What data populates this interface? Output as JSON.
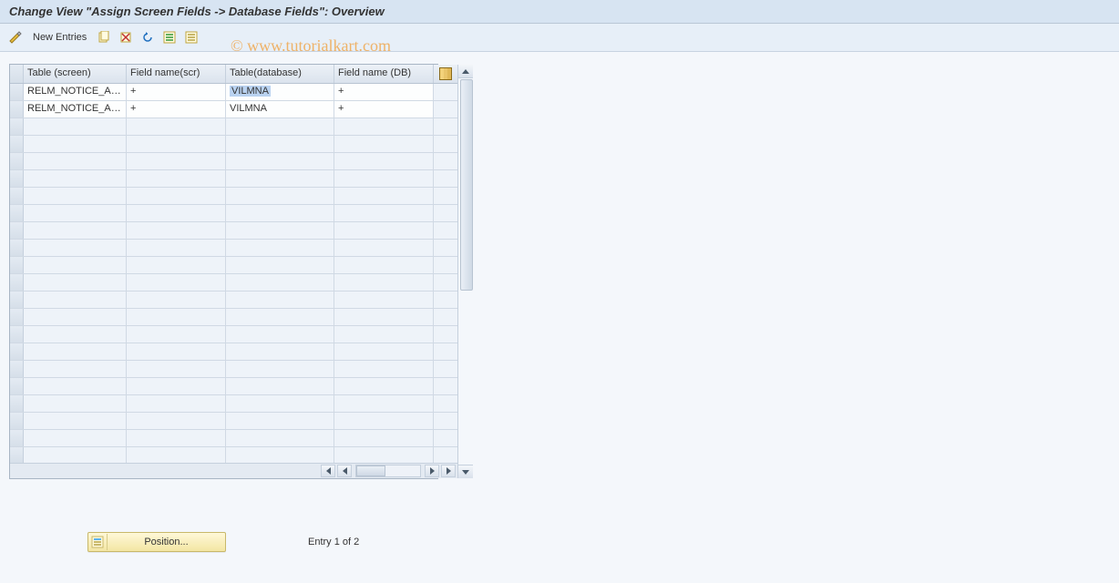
{
  "title": "Change View \"Assign Screen Fields -> Database Fields\": Overview",
  "toolbar": {
    "new_entries_label": "New Entries"
  },
  "watermark": "© www.tutorialkart.com",
  "table": {
    "headers": {
      "col_a": "Table (screen)",
      "col_b": "Field name(scr)",
      "col_c": "Table(database)",
      "col_d": "Field name (DB)"
    },
    "rows": [
      {
        "screen_table": "RELM_NOTICE_AS…",
        "field_scr": "+",
        "db_table": "VILMNA",
        "field_db": "+",
        "highlight": true
      },
      {
        "screen_table": "RELM_NOTICE_AS…",
        "field_scr": "+",
        "db_table": "VILMNA",
        "field_db": "+",
        "highlight": false
      }
    ],
    "empty_rows": 21
  },
  "footer": {
    "position_label": "Position...",
    "entry_status": "Entry 1 of 2"
  }
}
